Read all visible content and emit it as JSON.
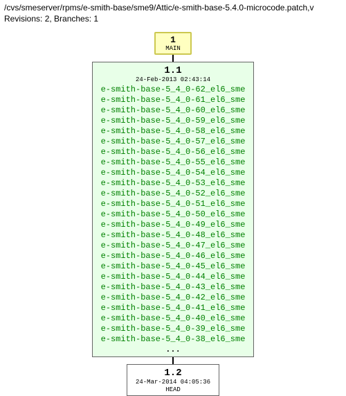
{
  "header": {
    "path": "/cvs/smeserver/rpms/e-smith-base/sme9/Attic/e-smith-base-5.4.0-microcode.patch,v",
    "meta_label": "Revisions: 2, Branches: 1"
  },
  "main": {
    "num": "1",
    "label": "MAIN"
  },
  "rev1": {
    "version": "1.1",
    "date": "24-Feb-2013 02:43:14",
    "tags": [
      "e-smith-base-5_4_0-62_el6_sme",
      "e-smith-base-5_4_0-61_el6_sme",
      "e-smith-base-5_4_0-60_el6_sme",
      "e-smith-base-5_4_0-59_el6_sme",
      "e-smith-base-5_4_0-58_el6_sme",
      "e-smith-base-5_4_0-57_el6_sme",
      "e-smith-base-5_4_0-56_el6_sme",
      "e-smith-base-5_4_0-55_el6_sme",
      "e-smith-base-5_4_0-54_el6_sme",
      "e-smith-base-5_4_0-53_el6_sme",
      "e-smith-base-5_4_0-52_el6_sme",
      "e-smith-base-5_4_0-51_el6_sme",
      "e-smith-base-5_4_0-50_el6_sme",
      "e-smith-base-5_4_0-49_el6_sme",
      "e-smith-base-5_4_0-48_el6_sme",
      "e-smith-base-5_4_0-47_el6_sme",
      "e-smith-base-5_4_0-46_el6_sme",
      "e-smith-base-5_4_0-45_el6_sme",
      "e-smith-base-5_4_0-44_el6_sme",
      "e-smith-base-5_4_0-43_el6_sme",
      "e-smith-base-5_4_0-42_el6_sme",
      "e-smith-base-5_4_0-41_el6_sme",
      "e-smith-base-5_4_0-40_el6_sme",
      "e-smith-base-5_4_0-39_el6_sme",
      "e-smith-base-5_4_0-38_el6_sme"
    ],
    "ellipsis": "..."
  },
  "rev2": {
    "version": "1.2",
    "date": "24-Mar-2014 04:05:36",
    "head": "HEAD"
  }
}
